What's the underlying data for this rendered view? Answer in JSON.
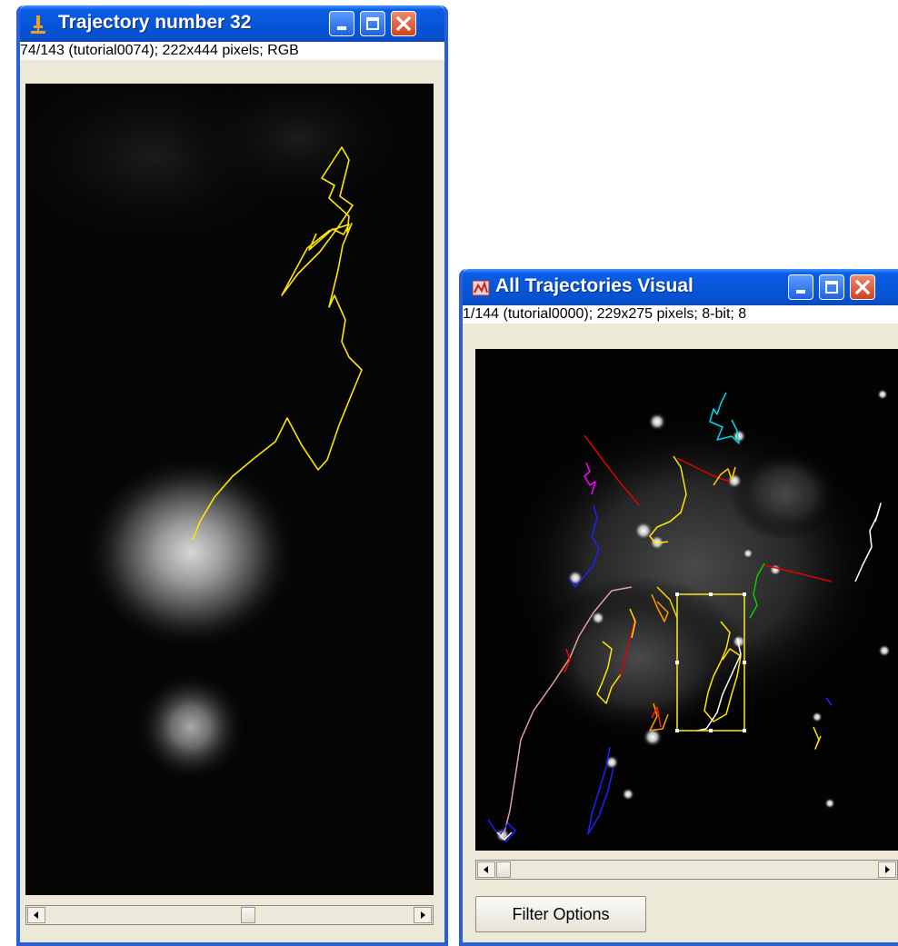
{
  "window_left": {
    "title": "Trajectory number 32",
    "info": "74/143 (tutorial0074); 222x444 pixels; RGB",
    "icon": "microscope-icon",
    "trajectory_color": "#ffe600"
  },
  "window_right": {
    "title": "All Trajectories Visual",
    "info": "1/144 (tutorial0000); 229x275 pixels; 8-bit; 8",
    "icon": "imagej-icon",
    "filter_button": "Filter Options",
    "selection_color": "#e8e020"
  },
  "icons": {
    "minimize": "minimize-icon",
    "maximize": "maximize-icon",
    "close": "close-icon",
    "scroll_left": "arrow-left-icon",
    "scroll_right": "arrow-right-icon"
  },
  "colors": {
    "titlebar": "#0757d9",
    "close_button": "#d2421e",
    "window_face": "#ece9d8"
  }
}
